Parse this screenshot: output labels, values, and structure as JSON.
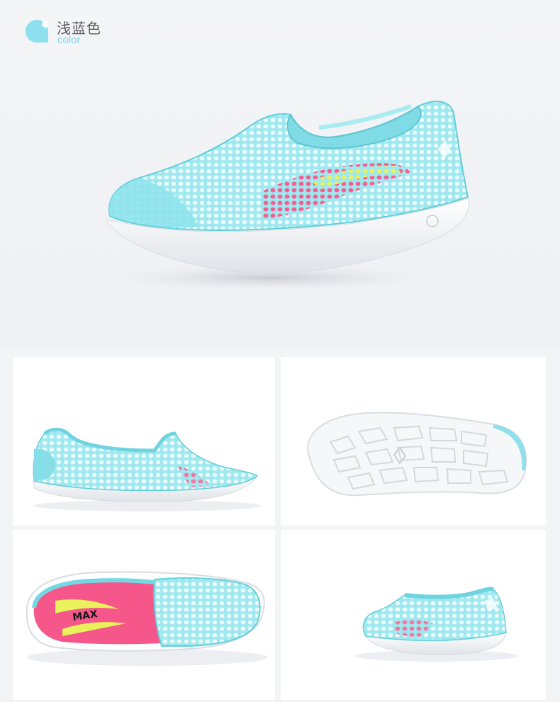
{
  "colorOption": {
    "name": "浅蓝色",
    "label": "color",
    "swatch": "#8ee0ee"
  },
  "palette": {
    "mesh": "#8ee6ee",
    "meshDark": "#63cfda",
    "sole": "#ffffff",
    "soleShade": "#e6e9ee",
    "insole": "#f35a86",
    "accentYellow": "#e9f25a"
  },
  "photos": [
    {
      "view": "side-angle"
    },
    {
      "view": "side-profile"
    },
    {
      "view": "outsole"
    },
    {
      "view": "top-down"
    },
    {
      "view": "rear-angle"
    }
  ]
}
